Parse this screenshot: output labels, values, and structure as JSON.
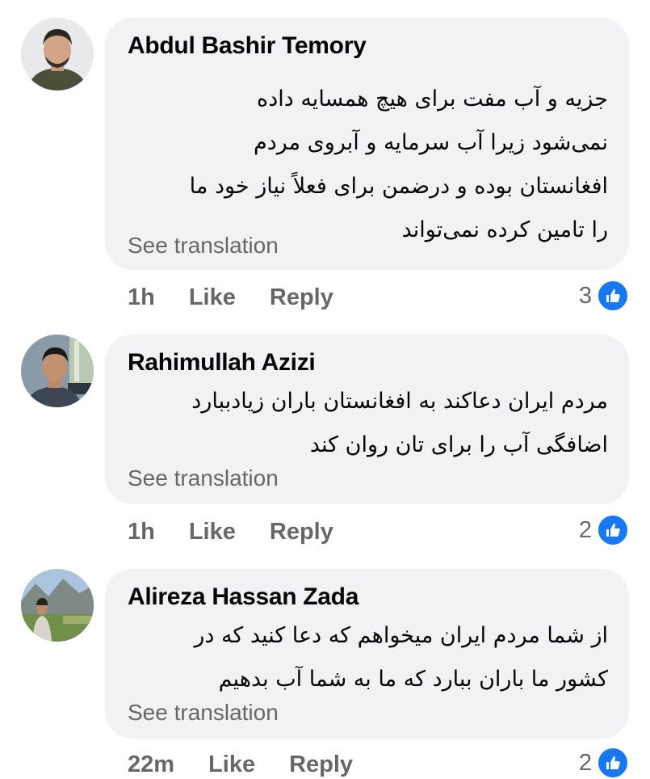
{
  "comments": [
    {
      "author": "Abdul Bashir Temory",
      "text": "جزیه و آب مفت برای هیچ همسایه داده\nنمی‌شود زیرا  آب سرمایه و  آبروی مردم\nافغانستان بوده و درضمن برای فعلاً نیاز خود ما\nرا تامین کرده نمی‌تواند",
      "see_translation": "See translation",
      "time": "1h",
      "like": "Like",
      "reply": "Reply",
      "reactions": "3"
    },
    {
      "author": "Rahimullah Azizi",
      "text": "مردم ایران دعاکند به افغانستان باران زیادببارد\nاضافگی آب را برای تان روان کند",
      "see_translation": "See translation",
      "time": "1h",
      "like": "Like",
      "reply": "Reply",
      "reactions": "2"
    },
    {
      "author": "Alireza Hassan Zada",
      "text": "از شما مردم ایران میخواهم که دعا کنید که در\nکشور ما باران ببارد که ما به شما آب بدهیم",
      "see_translation": "See translation",
      "time": "22m",
      "like": "Like",
      "reply": "Reply",
      "reactions": "2"
    }
  ],
  "icons": {
    "reaction": "like-thumb-icon"
  },
  "colors": {
    "bubble": "#f0f2f5",
    "like_blue": "#1877f2",
    "secondary_text": "#65676b"
  }
}
